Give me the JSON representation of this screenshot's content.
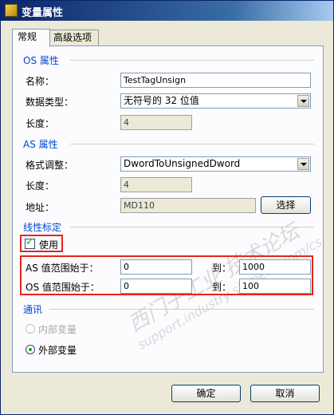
{
  "window": {
    "title": "变量属性"
  },
  "tabs": [
    {
      "label": "常规"
    },
    {
      "label": "高级选项"
    }
  ],
  "os_group": {
    "title": "OS 属性",
    "name_label": "名称：",
    "name_value": "TestTagUnsign",
    "type_label": "数据类型：",
    "type_value": "无符号的 32 位值",
    "length_label": "长度：",
    "length_value": "4"
  },
  "as_group": {
    "title": "AS 属性",
    "format_label": "格式调整：",
    "format_value": "DwordToUnsignedDword",
    "length_label": "长度：",
    "length_value": "4",
    "address_label": "地址：",
    "address_value": "MD110",
    "select_button": "选择"
  },
  "scaling_group": {
    "title": "线性标定",
    "use_label": "使用",
    "use_checked": true,
    "as_from_label": "AS 值范围始于：",
    "as_from_value": "0",
    "as_to_label": "到：",
    "as_to_value": "1000",
    "os_from_label": "OS 值范围始于：",
    "os_from_value": "0",
    "os_to_label": "到：",
    "os_to_value": "100"
  },
  "comm_group": {
    "title": "通讯",
    "internal_label": "内部变量",
    "external_label": "外部变量",
    "selected": "external"
  },
  "buttons": {
    "ok": "确定",
    "cancel": "取消"
  },
  "colors": {
    "group_title": "#0046d5",
    "highlight": "#e8231c",
    "titlebar": "#0a246a"
  }
}
